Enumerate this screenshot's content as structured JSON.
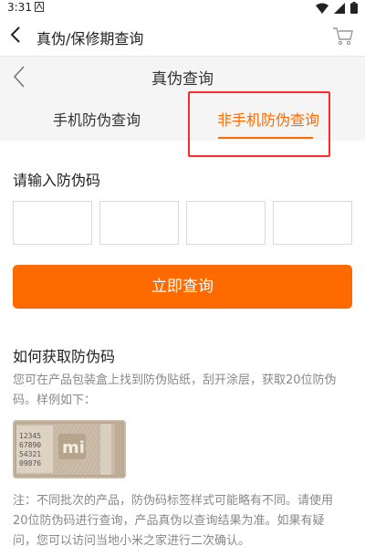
{
  "status": {
    "time": "3:31"
  },
  "app_bar": {
    "title": "真伪/保修期查询"
  },
  "sub_header": {
    "title": "真伪查询",
    "tabs": [
      {
        "label": "手机防伪查询"
      },
      {
        "label": "非手机防伪查询"
      }
    ]
  },
  "form": {
    "prompt": "请输入防伪码",
    "code_boxes": [
      "",
      "",
      "",
      ""
    ],
    "submit_label": "立即查询"
  },
  "howto": {
    "title": "如何获取防伪码",
    "desc": "您可在产品包装盒上找到防伪贴纸，刮开涂层，获取20位防伪码。样例如下：",
    "sticker": {
      "logo": "mi",
      "digits": [
        "12345",
        "67890",
        "54321",
        "09876"
      ]
    },
    "note": "注：不同批次的产品，防伪码标签样式可能略有不同。请使用20位防伪码进行查询，产品真伪以查询结果为准。如果有疑问，您可以访问当地小米之家进行二次确认。"
  },
  "colors": {
    "accent": "#ff6a00",
    "highlight": "#ff2b2b"
  }
}
